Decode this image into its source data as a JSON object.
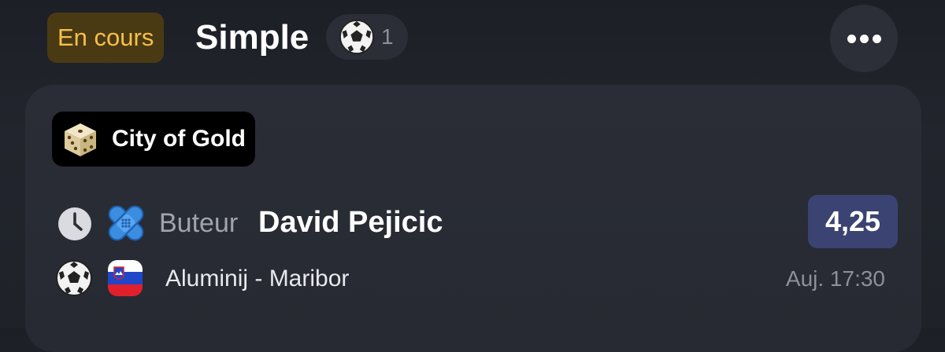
{
  "header": {
    "status": "En cours",
    "title": "Simple",
    "sport_icon": "soccer-ball-icon",
    "selection_count": "1",
    "more_icon": "more-horizontal-icon"
  },
  "card": {
    "event_chip": {
      "icon": "dice-icon",
      "label": "City of Gold"
    },
    "selection": {
      "status_icon": "clock-icon",
      "team_icon": "bandage-icon",
      "market": "Buteur",
      "player": "David Pejicic",
      "odds": "4,25"
    },
    "match": {
      "sport_icon": "soccer-ball-icon",
      "flag_icon": "slovenia-flag-icon",
      "name": "Aluminij - Maribor",
      "time": "Auj. 17:30"
    }
  },
  "colors": {
    "background": "#1f2229",
    "card": "#292c35",
    "status_badge_bg": "#4a3a14",
    "status_badge_text": "#f5c04a",
    "odds_bg": "#3a4371"
  }
}
